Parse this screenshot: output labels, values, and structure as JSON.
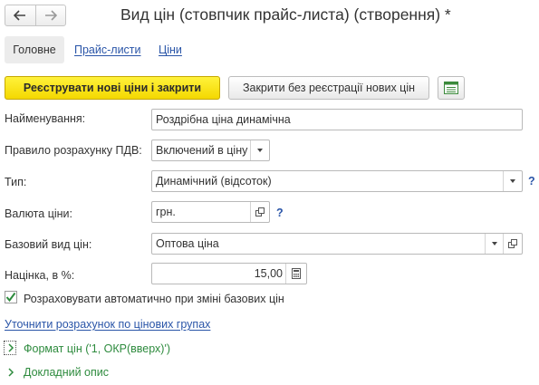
{
  "window": {
    "title": "Вид цін (стовпчик прайс-листа) (створення) *"
  },
  "tabs": [
    {
      "label": "Головне",
      "active": true
    },
    {
      "label": "Прайс-листи",
      "active": false
    },
    {
      "label": "Ціни",
      "active": false
    }
  ],
  "toolbar": {
    "primary_label": "Реєструвати нові ціни і закрити",
    "secondary_label": "Закрити без реєстрації нових цін",
    "settings_icon": "form-settings-icon"
  },
  "form": {
    "name": {
      "label": "Найменування:",
      "value": "Роздрібна ціна динамічна"
    },
    "vat": {
      "label": "Правило розрахунку ПДВ:",
      "value": "Включений в ціну"
    },
    "type": {
      "label": "Тип:",
      "value": "Динамічний (відсоток)",
      "help": "?"
    },
    "currency": {
      "label": "Валюта ціни:",
      "value": "грн.",
      "help": "?"
    },
    "base": {
      "label": "Базовий вид цін:",
      "value": "Оптова ціна"
    },
    "markup": {
      "label": "Націнка, в %:",
      "value": "15,00"
    }
  },
  "auto_calc": {
    "label": "Розраховувати автоматично при зміні базових цін",
    "checked": true
  },
  "refine_link": "Уточнити розрахунок по цінових групах",
  "price_format": "Формат цін ('1, ОКР(вверх)')",
  "detailed_description": "Докладний опис",
  "colors": {
    "accent_yellow": "#f4d800",
    "link_blue": "#2a55a8",
    "green": "#2e8b3e"
  }
}
